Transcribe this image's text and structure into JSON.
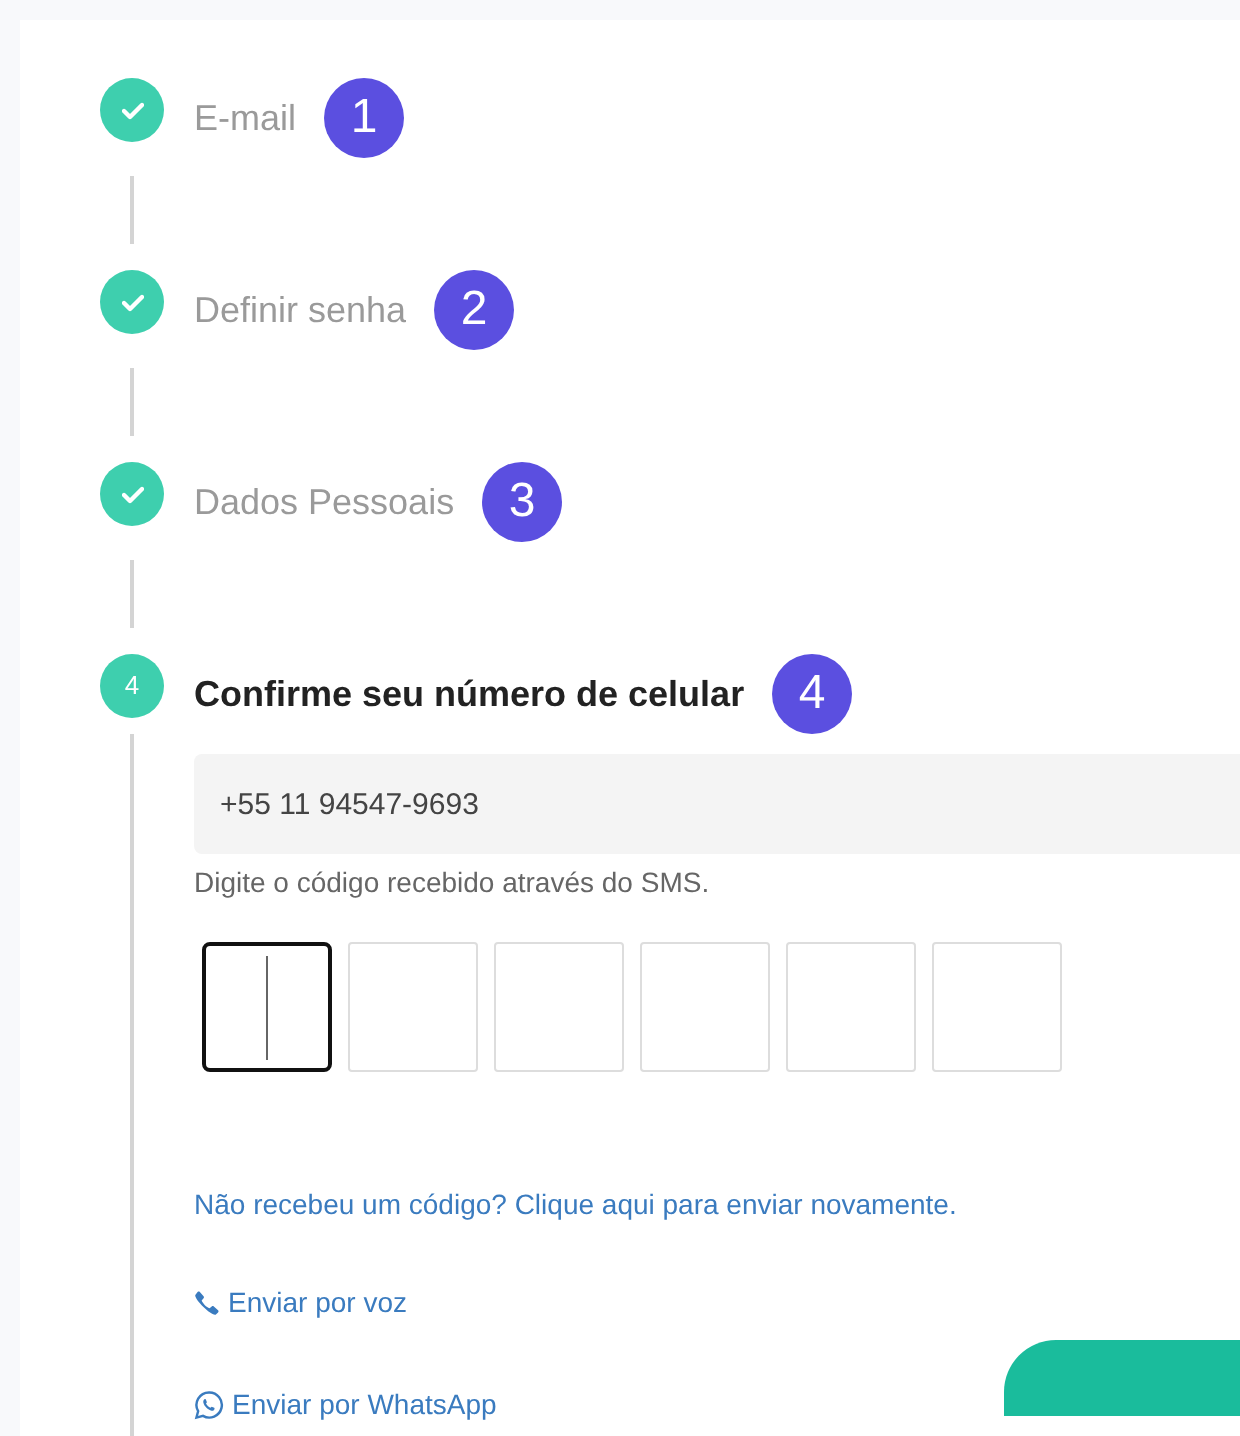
{
  "steps": [
    {
      "label": "E-mail",
      "badge": "1",
      "kind": "done"
    },
    {
      "label": "Definir senha",
      "badge": "2",
      "kind": "done"
    },
    {
      "label": "Dados Pessoais",
      "badge": "3",
      "kind": "done"
    },
    {
      "label": "Confirme seu número de celular",
      "badge": "4",
      "kind": "active",
      "number": "4"
    }
  ],
  "phone": {
    "value": "+55 11 94547-9693"
  },
  "hint": "Digite o código recebido através do SMS.",
  "code_boxes": [
    {
      "focused": true
    },
    {
      "focused": false
    },
    {
      "focused": false
    },
    {
      "focused": false
    },
    {
      "focused": false
    },
    {
      "focused": false
    }
  ],
  "resend_link": "Não recebeu um código? Clique aqui para enviar novamente.",
  "options": [
    {
      "kind": "voice",
      "label": "Enviar por voz"
    },
    {
      "kind": "whatsapp",
      "label": "Enviar por WhatsApp"
    }
  ]
}
